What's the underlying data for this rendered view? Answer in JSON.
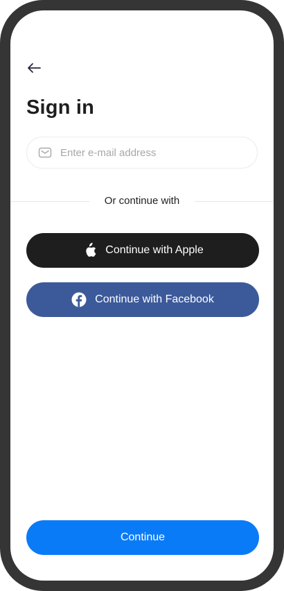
{
  "header": {
    "title": "Sign in"
  },
  "email": {
    "placeholder": "Enter e-mail address",
    "value": ""
  },
  "divider": {
    "label": "Or continue with"
  },
  "social": {
    "apple_label": "Continue with Apple",
    "facebook_label": "Continue with Facebook"
  },
  "footer": {
    "continue_label": "Continue"
  },
  "colors": {
    "apple_button": "#1e1e1e",
    "facebook_button": "#3c5a9a",
    "continue_button": "#0a7bf7",
    "frame": "#353535"
  },
  "icons": {
    "back": "arrow-left-icon",
    "email": "mail-icon",
    "apple": "apple-icon",
    "facebook": "facebook-icon"
  }
}
